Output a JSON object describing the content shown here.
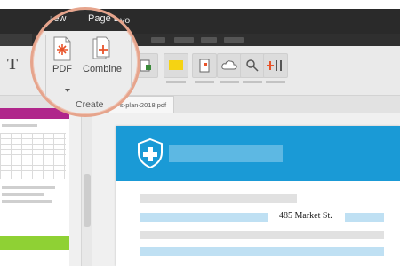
{
  "menubar": {
    "view_label": "iew",
    "layout_label": "Page Layo"
  },
  "toolbar": {
    "text_tool_glyph": "T",
    "create_group": {
      "pdf_label": "PDF",
      "combine_label": "Combine",
      "group_label": "Create",
      "extra_label": "V"
    },
    "tools": [
      {
        "icon": "export-icon"
      },
      {
        "icon": "note-icon",
        "color": "#f5d313"
      },
      {
        "icon": "document-icon"
      },
      {
        "icon": "cloud-icon"
      },
      {
        "icon": "search-icon"
      },
      {
        "icon": "tools-icon"
      }
    ]
  },
  "document": {
    "tab_label": "s-plan-2018.pdf",
    "address": "485 Market St."
  },
  "colors": {
    "banner": "#1a9ad6",
    "thumb_magenta": "#b0268b",
    "thumb_green": "#8fd134",
    "callout_ring": "#e6a48c",
    "pdf_accent": "#e8532a"
  }
}
